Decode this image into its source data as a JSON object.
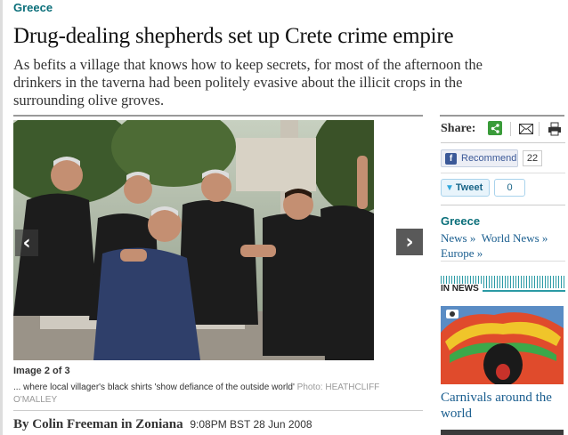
{
  "article": {
    "section": "Greece",
    "headline": "Drug-dealing shepherds set up Crete crime empire",
    "standfirst": "As befits a village that knows how to keep secrets, for most of the afternoon the drinkers in the taverna had been politely evasive about the illicit crops in the surrounding olive groves.",
    "gallery": {
      "counter": "Image 2 of 3",
      "caption": "... where local villager's black shirts 'show defiance of the outside world'",
      "credit": "Photo: HEATHCLIFF O'MALLEY",
      "prev_icon": "chevron-left-icon",
      "next_icon": "chevron-right-icon"
    },
    "byline": "By Colin Freeman in Zoniana",
    "dateline": "9:08PM BST 28 Jun 2008"
  },
  "sidebar": {
    "share_label": "Share:",
    "share_icons": [
      "share-icon",
      "mail-icon",
      "print-icon"
    ],
    "facebook": {
      "label": "Recommend",
      "count": "22"
    },
    "twitter": {
      "label": "Tweet",
      "count": "0"
    },
    "tags": {
      "title": "Greece",
      "links": [
        {
          "label": "News »"
        },
        {
          "label": "World News »"
        },
        {
          "label": "Europe »"
        }
      ]
    },
    "in_news": {
      "label": "IN NEWS",
      "story_title": "Carnivals around the world"
    }
  },
  "colors": {
    "section": "#0b6f7a",
    "link": "#1a5e8f",
    "share_green": "#3a9b3a",
    "facebook": "#3b5998",
    "twitter": "#2fa6da",
    "news_accent": "#2a9aa5"
  }
}
